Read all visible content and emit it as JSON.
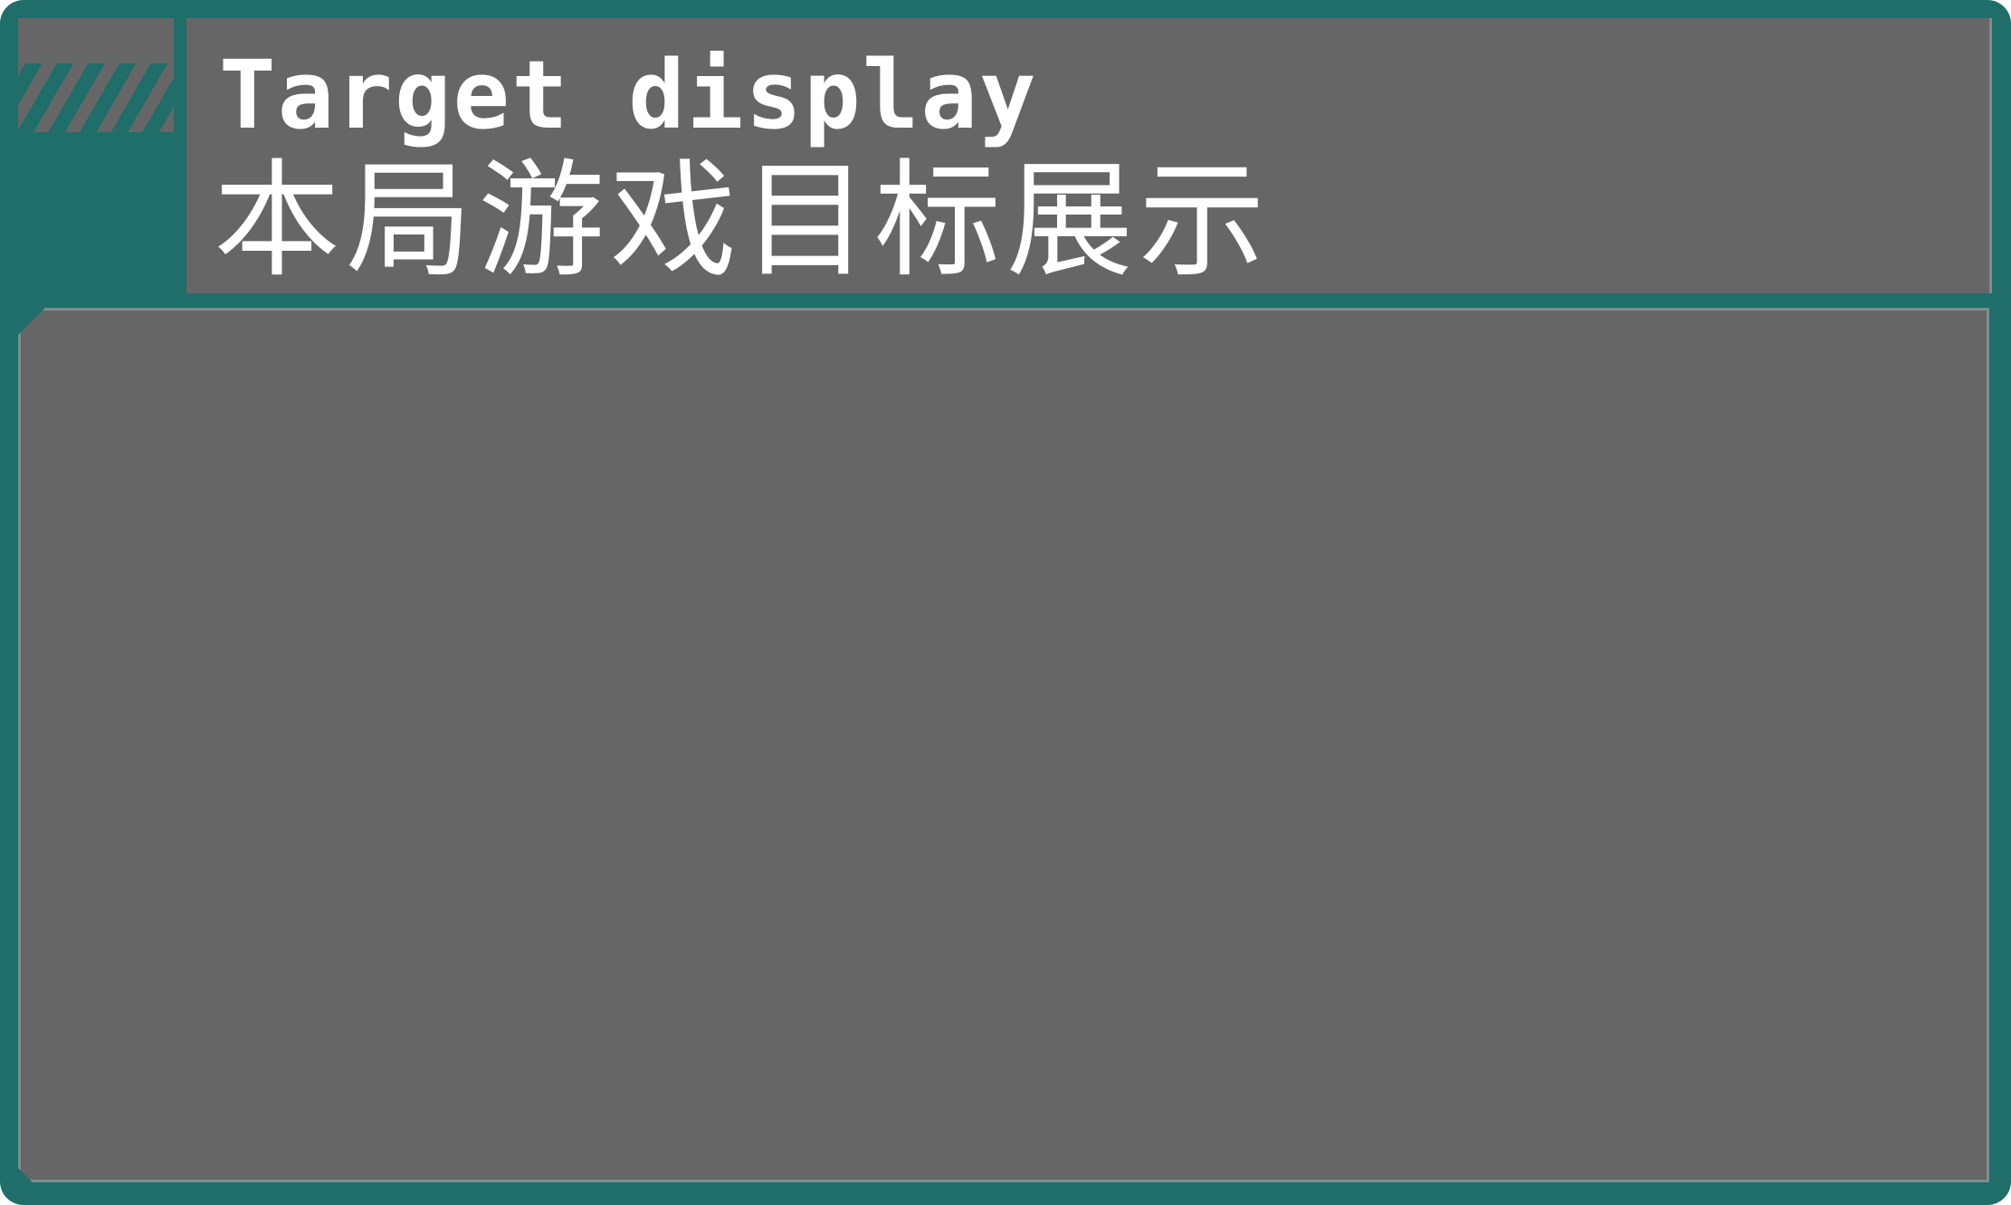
{
  "panel": {
    "title_en": "Target display",
    "title_cn": "本局游戏目标展示"
  },
  "colors": {
    "frame": "#1f6e6a",
    "panel": "#666666",
    "text": "#ffffff"
  }
}
